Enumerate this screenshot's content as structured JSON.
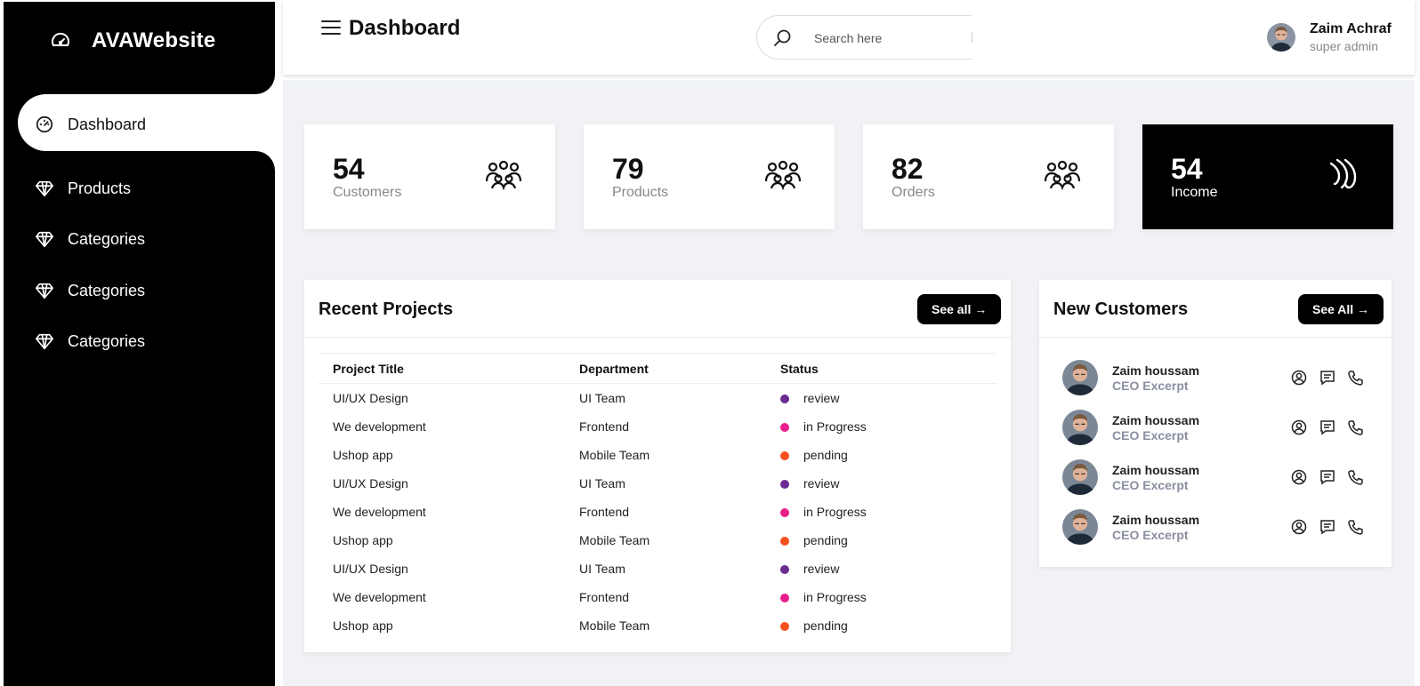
{
  "app": {
    "brand": "AVAWebsite"
  },
  "sidebar": {
    "items": [
      {
        "label": "Dashboard",
        "icon": "dashboard-icon",
        "active": true
      },
      {
        "label": "Products",
        "icon": "diamond-icon",
        "active": false
      },
      {
        "label": "Categories",
        "icon": "diamond-icon",
        "active": false
      },
      {
        "label": "Categories",
        "icon": "diamond-icon",
        "active": false
      },
      {
        "label": "Categories",
        "icon": "diamond-icon",
        "active": false
      }
    ]
  },
  "header": {
    "title": "Dashboard",
    "search_placeholder": "Search here",
    "user": {
      "name": "Zaim Achraf",
      "role": "super admin"
    }
  },
  "cards": [
    {
      "value": "54",
      "label": "Customers",
      "icon": "people-icon",
      "dark": false
    },
    {
      "value": "79",
      "label": "Products",
      "icon": "people-icon",
      "dark": false
    },
    {
      "value": "82",
      "label": "Orders",
      "icon": "people-icon",
      "dark": false
    },
    {
      "value": "54",
      "label": "Income",
      "icon": "wave-icon",
      "dark": true
    }
  ],
  "projects": {
    "title": "Recent Projects",
    "see_all": "See all →",
    "columns": [
      "Project Title",
      "Department",
      "Status"
    ],
    "rows": [
      {
        "title": "UI/UX Design",
        "dept": "UI Team",
        "status": "review",
        "color": "#6a2c91"
      },
      {
        "title": "We development",
        "dept": "Frontend",
        "status": "in Progress",
        "color": "#e91e8c"
      },
      {
        "title": "Ushop app",
        "dept": "Mobile Team",
        "status": "pending",
        "color": "#f4511e"
      },
      {
        "title": "UI/UX Design",
        "dept": "UI Team",
        "status": "review",
        "color": "#6a2c91"
      },
      {
        "title": "We development",
        "dept": "Frontend",
        "status": "in Progress",
        "color": "#e91e8c"
      },
      {
        "title": "Ushop app",
        "dept": "Mobile Team",
        "status": "pending",
        "color": "#f4511e"
      },
      {
        "title": "UI/UX Design",
        "dept": "UI Team",
        "status": "review",
        "color": "#6a2c91"
      },
      {
        "title": "We development",
        "dept": "Frontend",
        "status": "in Progress",
        "color": "#e91e8c"
      },
      {
        "title": "Ushop app",
        "dept": "Mobile Team",
        "status": "pending",
        "color": "#f4511e"
      }
    ]
  },
  "customers": {
    "title": "New Customers",
    "see_all": "See All →",
    "list": [
      {
        "name": "Zaim houssam",
        "role": "CEO Excerpt"
      },
      {
        "name": "Zaim houssam",
        "role": "CEO Excerpt"
      },
      {
        "name": "Zaim houssam",
        "role": "CEO Excerpt"
      },
      {
        "name": "Zaim houssam",
        "role": "CEO Excerpt"
      }
    ]
  }
}
